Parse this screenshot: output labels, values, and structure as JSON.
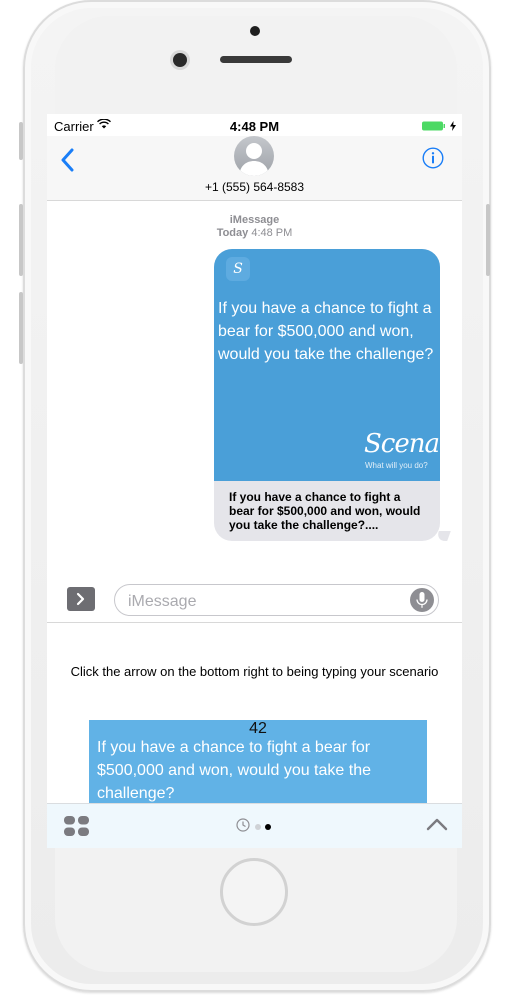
{
  "status_bar": {
    "carrier": "Carrier",
    "time": "4:48 PM",
    "battery_color": "#4cd964"
  },
  "nav_bar": {
    "contact_number": "+1 (555) 564-8583",
    "accent_color": "#1a7ef7"
  },
  "conversation": {
    "service": "iMessage",
    "day": "Today",
    "time": "4:48 PM",
    "message": {
      "app_icon_letter": "S",
      "question": "If you have a chance to fight a bear for $500,000 and won, would you take the challenge?",
      "brand_name": "Scenari",
      "brand_tagline": "What will you do?",
      "caption": "If you have a chance to fight a bear for $500,000 and won, would you take the challenge?....",
      "bubble_color": "#4a9fd8"
    }
  },
  "input_bar": {
    "placeholder": "iMessage"
  },
  "app_panel": {
    "instruction": "Click the arrow on the bottom right to being typing your scenario",
    "card_number": "42",
    "card_question": "If you have a chance to fight a bear for $500,000 and won, would you take the challenge?",
    "card_color": "#61b2e6"
  },
  "tray": {
    "page_count": 2,
    "active_page": 2
  }
}
